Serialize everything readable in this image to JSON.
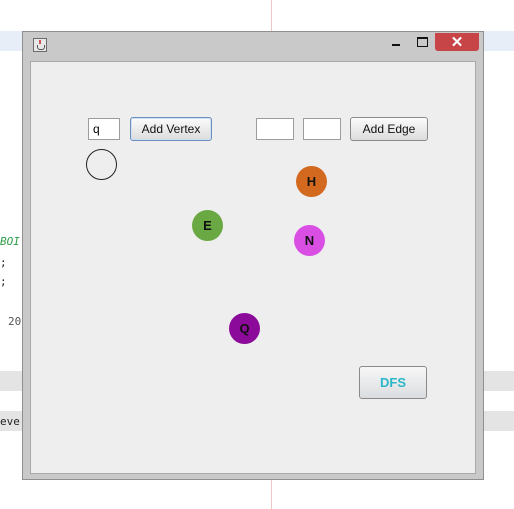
{
  "background": {
    "code_lines": [
      "BOI",
      ";",
      ";",
      "20",
      "eve"
    ]
  },
  "window": {
    "title": "",
    "controls": {
      "minimize": "minimize-icon",
      "maximize": "maximize-icon",
      "close": "close-icon"
    },
    "close_glyph": "✕"
  },
  "toolbar": {
    "vertex_input_value": "q",
    "add_vertex_label": "Add Vertex",
    "edge_from_value": "",
    "edge_to_value": "",
    "add_edge_label": "Add Edge"
  },
  "graph": {
    "vertices": [
      {
        "label": "",
        "color": ""
      },
      {
        "label": "H",
        "color": "#d2691e"
      },
      {
        "label": "E",
        "color": "#6aa843"
      },
      {
        "label": "N",
        "color": "#d94fe3"
      },
      {
        "label": "Q",
        "color": "#8b0a9a"
      }
    ]
  },
  "dfs_button": {
    "label": "DFS",
    "color": "#2ab7c9"
  }
}
